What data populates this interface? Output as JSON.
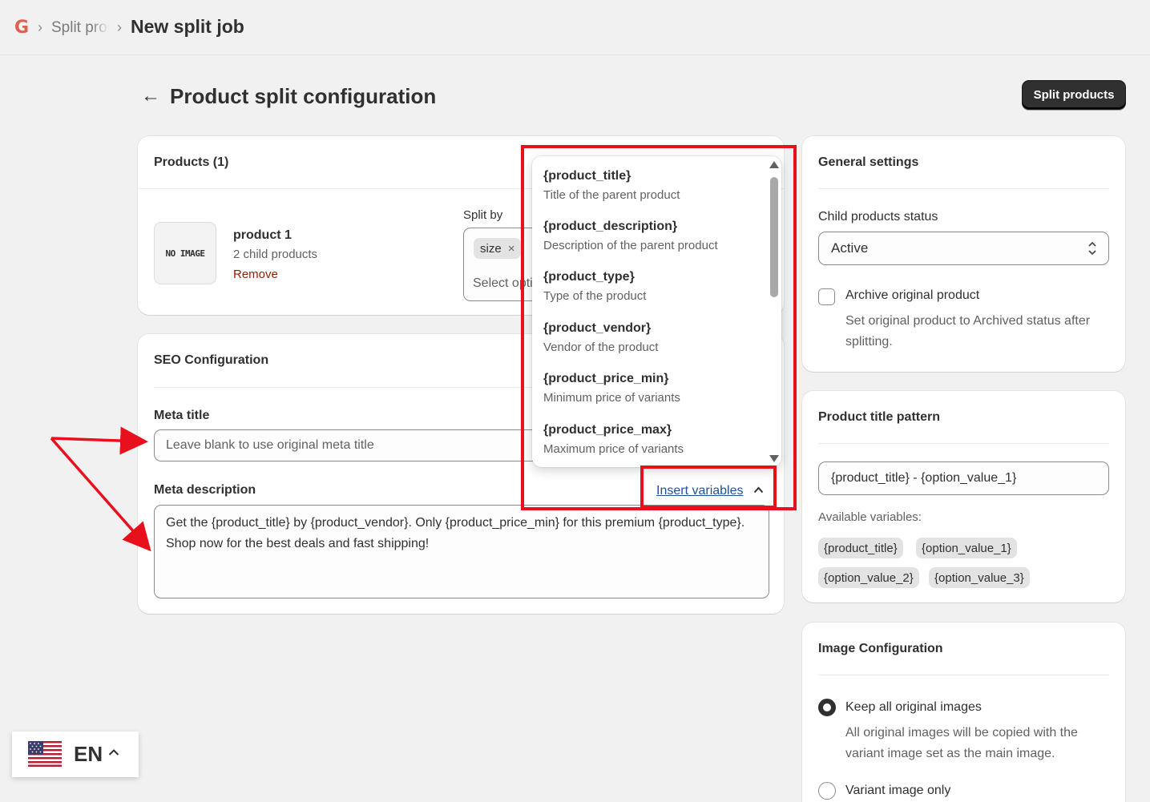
{
  "breadcrumb": {
    "logo": "G",
    "sep": "›",
    "previous": "Split products",
    "current": "New split job"
  },
  "header": {
    "back": "←",
    "title": "Product split configuration",
    "primary_button": "Split products"
  },
  "products_card": {
    "title": "Products (1)",
    "no_image": "NO IMAGE",
    "product_name": "product 1",
    "child_count": "2 child products",
    "remove": "Remove",
    "split_by_label": "Split by",
    "tag": "size",
    "tag_remove": "×",
    "select_placeholder": "Select options"
  },
  "seo_card": {
    "title": "SEO Configuration",
    "meta_title_label": "Meta title",
    "meta_title_placeholder": "Leave blank to use original meta title",
    "meta_description_label": "Meta description",
    "insert_variables": "Insert variables",
    "meta_description_value": "Get the {product_title} by {product_vendor}. Only {product_price_min} for this premium {product_type}. Shop now for the best deals and fast shipping!"
  },
  "variables_popover": {
    "items": [
      {
        "name": "{product_title}",
        "desc": "Title of the parent product"
      },
      {
        "name": "{product_description}",
        "desc": "Description of the parent product"
      },
      {
        "name": "{product_type}",
        "desc": "Type of the product"
      },
      {
        "name": "{product_vendor}",
        "desc": "Vendor of the product"
      },
      {
        "name": "{product_price_min}",
        "desc": "Minimum price of variants"
      },
      {
        "name": "{product_price_max}",
        "desc": "Maximum price of variants"
      }
    ]
  },
  "general_settings": {
    "title": "General settings",
    "status_label": "Child products status",
    "status_value": "Active",
    "archive_label": "Archive original product",
    "archive_help": "Set original product to Archived status after splitting."
  },
  "title_pattern": {
    "title": "Product title pattern",
    "value": "{product_title} - {option_value_1}",
    "available_label": "Available variables:",
    "chips": [
      "{product_title}",
      "{option_value_1}",
      "{option_value_2}",
      "{option_value_3}"
    ]
  },
  "image_config": {
    "title": "Image Configuration",
    "option1_label": "Keep all original images",
    "option1_help": "All original images will be copied with the variant image set as the main image.",
    "option2_label": "Variant image only"
  },
  "language": {
    "code": "EN",
    "caret": "^"
  },
  "colors": {
    "annotation_red": "#e8101c",
    "primary_button": "#303030",
    "link": "#1f5199",
    "destructive": "#8e1f0b"
  }
}
